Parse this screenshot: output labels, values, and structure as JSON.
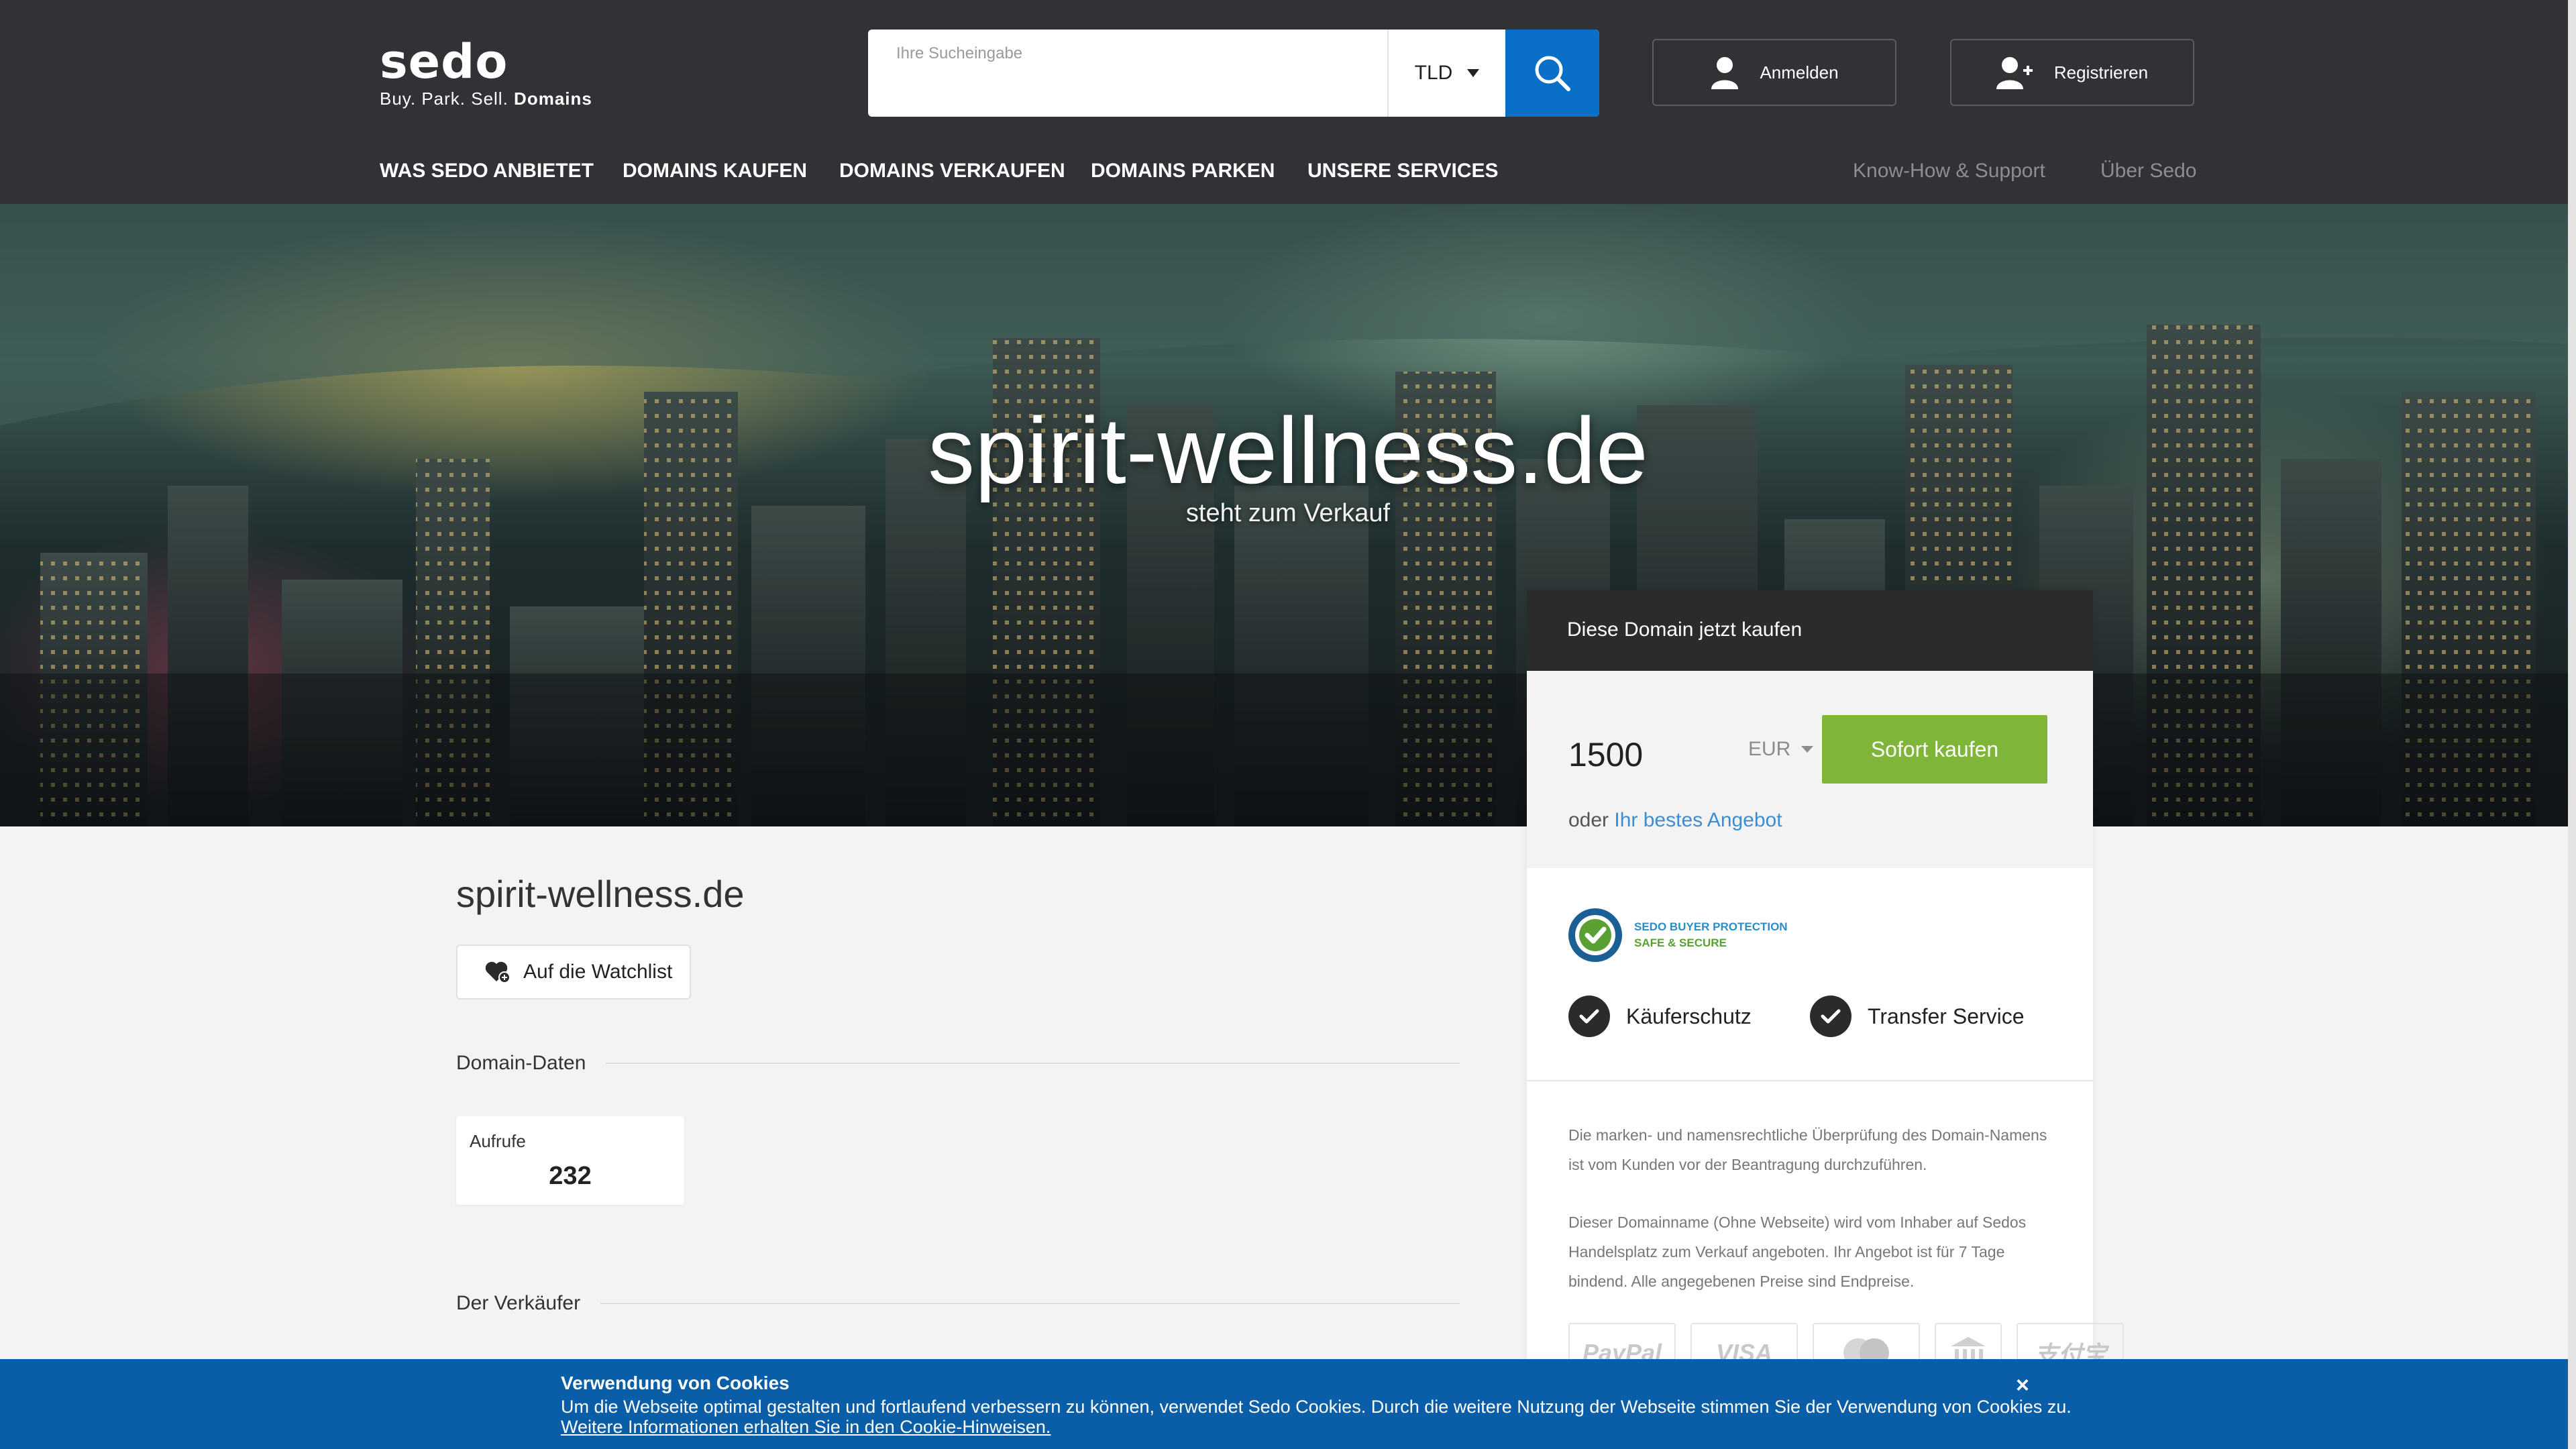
{
  "brand": {
    "name": "sedo",
    "tagline_plain": "Buy. Park. Sell.",
    "tagline_bold": "Domains"
  },
  "search": {
    "placeholder": "Ihre Sucheingabe",
    "tld_label": "TLD",
    "button_icon": "search-icon"
  },
  "header_buttons": {
    "login": "Anmelden",
    "register": "Registrieren"
  },
  "nav": {
    "primary": [
      "WAS SEDO ANBIETET",
      "DOMAINS KAUFEN",
      "DOMAINS VERKAUFEN",
      "DOMAINS PARKEN",
      "UNSERE SERVICES"
    ],
    "secondary": [
      "Know-How & Support",
      "Über Sedo"
    ]
  },
  "hero": {
    "domain": "spirit-wellness.de",
    "subtitle": "steht zum Verkauf"
  },
  "buybox": {
    "heading": "Diese Domain jetzt kaufen",
    "price": "1500",
    "currency": "EUR",
    "buy_button": "Sofort kaufen",
    "offer_prefix": "oder",
    "offer_link": "Ihr bestes Angebot",
    "protection_line1": "SEDO BUYER PROTECTION",
    "protection_line2": "SAFE & SECURE",
    "features": [
      "Käuferschutz",
      "Transfer Service"
    ],
    "legal_1": "Die marken- und namensrechtliche Überprüfung des Domain-Namens ist vom Kunden vor der Beantragung durchzuführen.",
    "legal_2": "Dieser Domainname (Ohne Webseite) wird vom Inhaber auf Sedos Handelsplatz zum Verkauf angeboten. Ihr Angebot ist für 7 Tage bindend. Alle angegebenen Preise sind Endpreise.",
    "payment_methods": [
      "PayPal",
      "VISA",
      "MasterCard",
      "Bank",
      "支付宝"
    ]
  },
  "main": {
    "domain": "spirit-wellness.de",
    "watchlist_button": "Auf die Watchlist",
    "section_domain_data": "Domain-Daten",
    "stat_label": "Aufrufe",
    "stat_value": "232",
    "section_seller": "Der Verkäufer"
  },
  "cookie": {
    "title": "Verwendung von Cookies",
    "text": "Um die Webseite optimal gestalten und fortlaufend verbessern zu können, verwendet Sedo Cookies. Durch die weitere Nutzung der Webseite stimmen Sie der Verwendung von Cookies zu.",
    "link": "Weitere Informationen erhalten Sie in den Cookie-Hinweisen.",
    "close": "×"
  },
  "colors": {
    "header_bg": "#303236",
    "accent_blue": "#0a6fc6",
    "buy_green": "#7fb539",
    "cookie_bg": "#0a5ea8"
  }
}
